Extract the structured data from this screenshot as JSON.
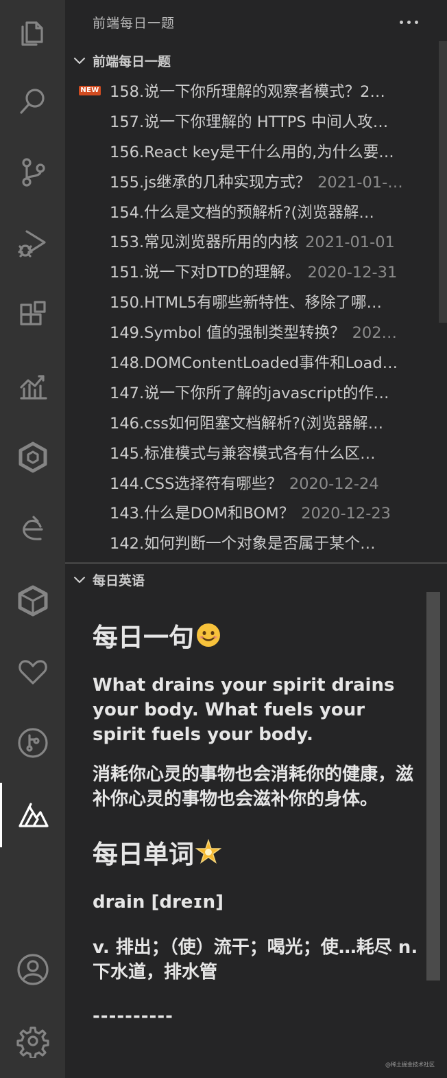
{
  "sidebar": {
    "title": "前端每日一题",
    "more_label": "···"
  },
  "section_questions": {
    "title": "前端每日一题",
    "new_badge": "NEW",
    "items": [
      {
        "label": "158.说一下你所理解的观察者模式？2…",
        "date": ""
      },
      {
        "label": "157.说一下你理解的 HTTPS 中间人攻…",
        "date": ""
      },
      {
        "label": "156.React key是干什么用的,为什么要…",
        "date": ""
      },
      {
        "label": "155.js继承的几种实现方式？",
        "date": "2021-01-…"
      },
      {
        "label": "154.什么是文档的预解析?(浏览器解…",
        "date": ""
      },
      {
        "label": "153.常见浏览器所用的内核",
        "date": "2021-01-01"
      },
      {
        "label": "151.说一下对DTD的理解。",
        "date": "2020-12-31"
      },
      {
        "label": "150.HTML5有哪些新特性、移除了哪…",
        "date": ""
      },
      {
        "label": "149.Symbol 值的强制类型转换？",
        "date": "202…"
      },
      {
        "label": "148.DOMContentLoaded事件和Load…",
        "date": ""
      },
      {
        "label": "147.说一下你所了解的javascript的作…",
        "date": ""
      },
      {
        "label": "146.css如何阻塞文档解析?(浏览器解…",
        "date": ""
      },
      {
        "label": "145.标准模式与兼容模式各有什么区…",
        "date": ""
      },
      {
        "label": "144.CSS选择符有哪些？",
        "date": "2020-12-24"
      },
      {
        "label": "143.什么是DOM和BOM？",
        "date": "2020-12-23"
      },
      {
        "label": "142.如何判断一个对象是否属于某个…",
        "date": ""
      }
    ]
  },
  "section_english": {
    "title": "每日英语",
    "sentence_heading": "每日一句",
    "sentence_en": "What drains your spirit drains your body. What fuels your spirit fuels your body.",
    "sentence_cn": "消耗你心灵的事物也会消耗你的健康，滋补你心灵的事物也会滋补你的身体。",
    "word_heading": "每日单词",
    "word": "drain [dreɪn]",
    "word_meaning": "v. 排出；（使）流干；喝光；使…耗尽 n. 下水道，排水管",
    "separator": "----------"
  },
  "watermark": "@稀土掘金技术社区",
  "colors": {
    "activity_bar": "#333333",
    "sidebar": "#252526",
    "new_badge": "#d14c21",
    "text": "#cccccc",
    "date": "#8b8b8b"
  }
}
